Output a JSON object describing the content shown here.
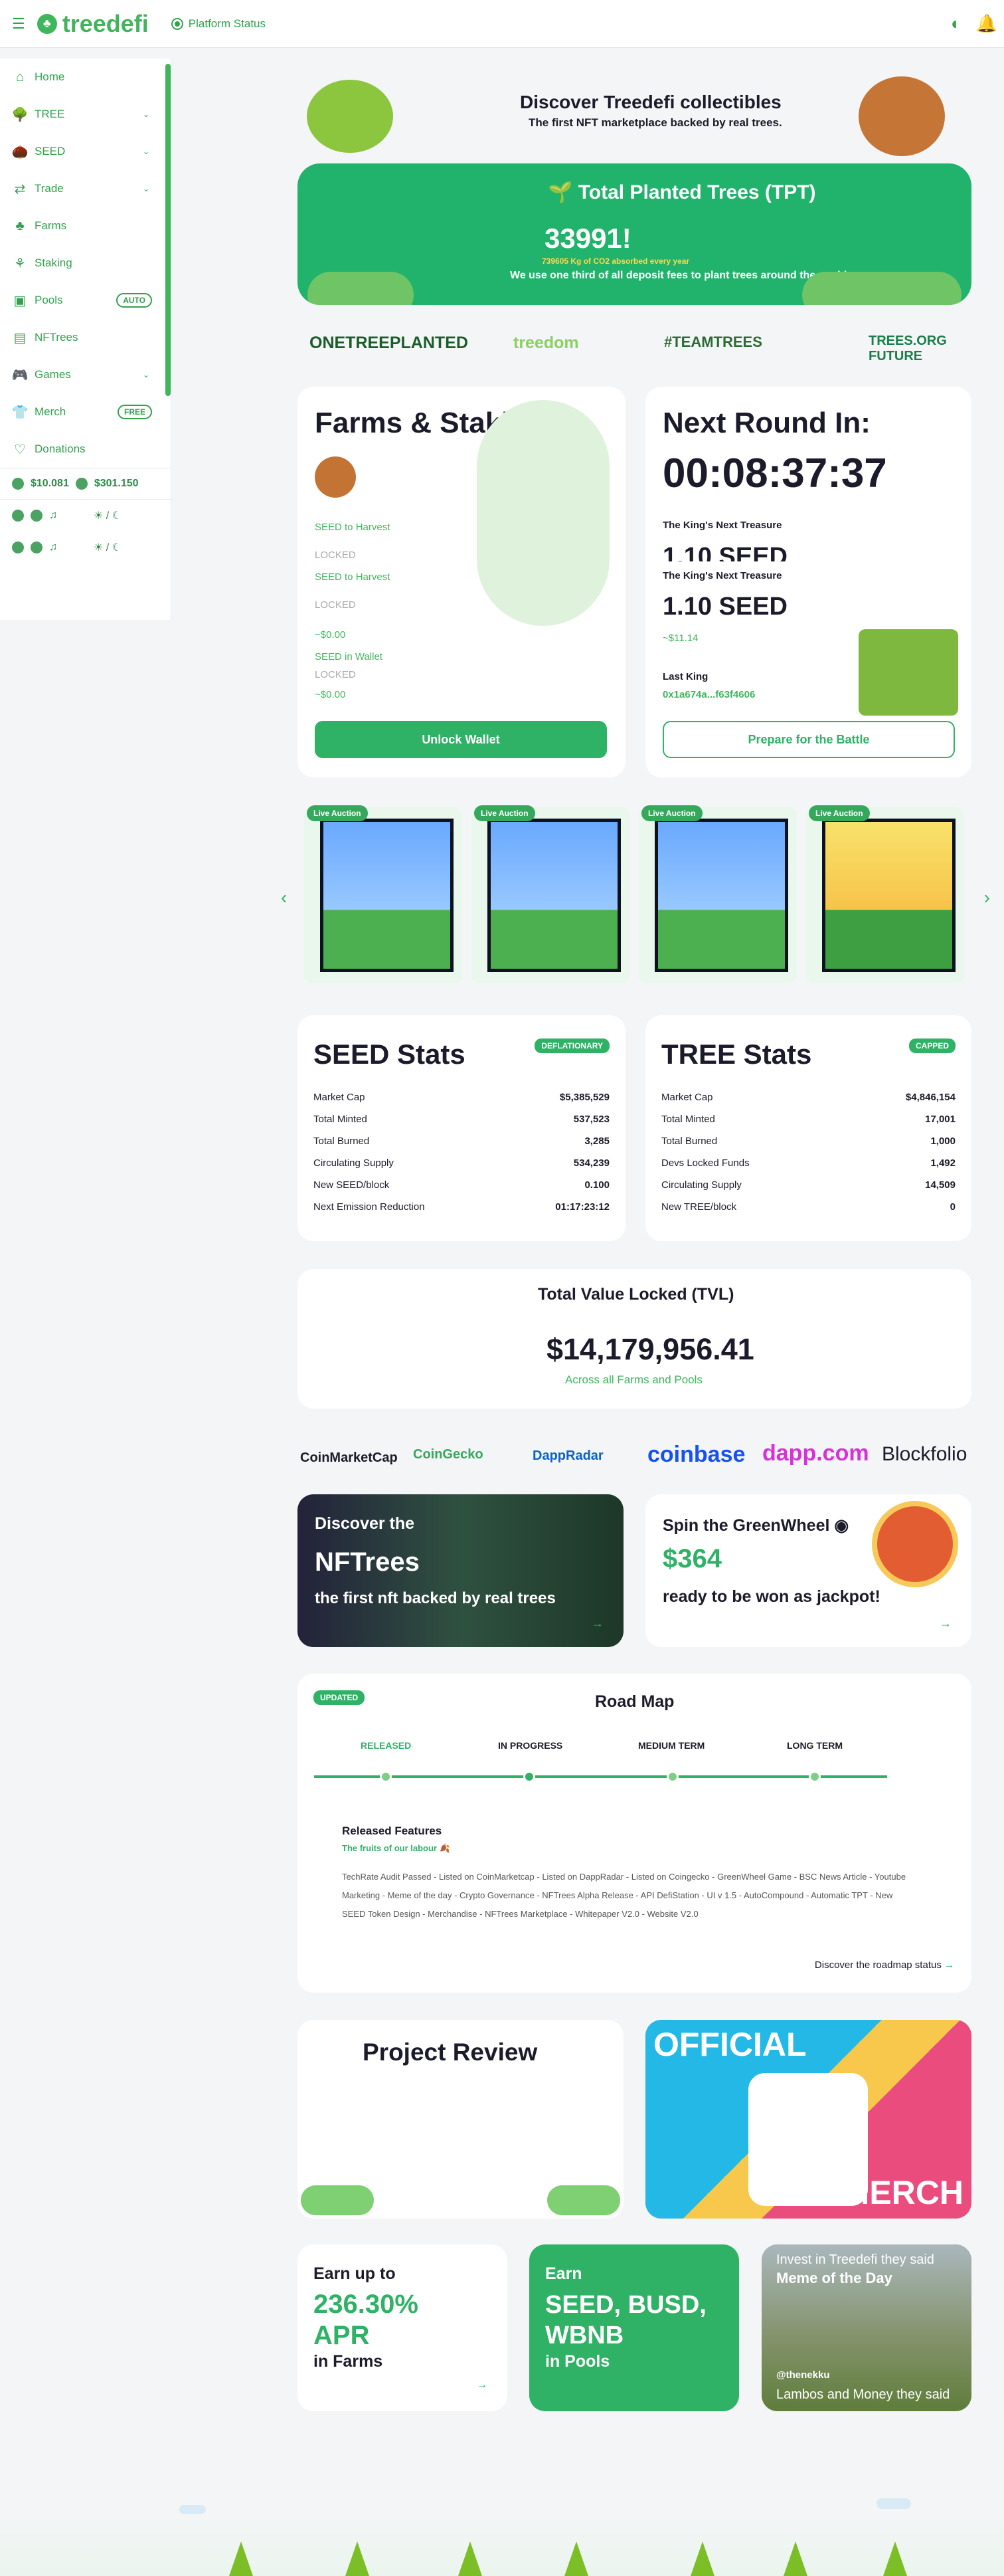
{
  "top": {
    "title": "treedefi",
    "status": "Platform Status"
  },
  "sidebar": {
    "items": [
      {
        "label": "Home"
      },
      {
        "label": "TREE"
      },
      {
        "label": "SEED"
      },
      {
        "label": "Trade"
      },
      {
        "label": "Farms"
      },
      {
        "label": "Staking"
      },
      {
        "label": "Pools",
        "badge": "AUTO"
      },
      {
        "label": "NFTrees"
      },
      {
        "label": "Games"
      },
      {
        "label": "Merch",
        "badge": "FREE"
      },
      {
        "label": "Donations"
      }
    ],
    "tree_price": "$10.081",
    "seed_price": "$301.150"
  },
  "hero": {
    "title": "Discover Treedefi collectibles",
    "subtitle": "The first NFT marketplace backed by real trees."
  },
  "tpt": {
    "title": "Total Planted Trees (TPT)",
    "count": "33991!",
    "co2": "739605 Kg of CO2 absorbed every year",
    "desc": "We use one third of all deposit fees to plant trees around the world"
  },
  "partners": [
    "ONETREEPLANTED",
    "treedom",
    "#TEAMTREES",
    "TREES.ORG FUTURE"
  ],
  "farms": {
    "title": "Farms & Staking",
    "seed_harvest": "SEED to Harvest",
    "locked": "LOCKED",
    "seed_wallet": "SEED in Wallet",
    "value": "~$0.00",
    "button": "Unlock Wallet"
  },
  "round": {
    "title": "Next Round In:",
    "timer": "00:08:37:37",
    "treasure_label": "The King's Next Treasure",
    "treasure_value": "1.10 SEED",
    "treasure_usd": "~$11.14",
    "last_king": "Last King",
    "last_king_addr": "0x1a674a...f63f4606",
    "button": "Prepare for the Battle"
  },
  "auctions": [
    {
      "tag": "Live Auction"
    },
    {
      "tag": "Live Auction"
    },
    {
      "tag": "Live Auction"
    },
    {
      "tag": "Live Auction"
    }
  ],
  "seed_stats": {
    "title": "SEED Stats",
    "badge": "DEFLATIONARY",
    "rows": [
      [
        "Market Cap",
        "$5,385,529"
      ],
      [
        "Total Minted",
        "537,523"
      ],
      [
        "Total Burned",
        "3,285"
      ],
      [
        "Circulating Supply",
        "534,239"
      ],
      [
        "New SEED/block",
        "0.100"
      ],
      [
        "Next Emission Reduction",
        "01:17:23:12"
      ]
    ]
  },
  "tree_stats": {
    "title": "TREE Stats",
    "badge": "CAPPED",
    "rows": [
      [
        "Market Cap",
        "$4,846,154"
      ],
      [
        "Total Minted",
        "17,001"
      ],
      [
        "Total Burned",
        "1,000"
      ],
      [
        "Devs Locked Funds",
        "1,492"
      ],
      [
        "Circulating Supply",
        "14,509"
      ],
      [
        "New TREE/block",
        "0"
      ]
    ]
  },
  "tvl": {
    "title": "Total Value Locked (TVL)",
    "value": "$14,179,956.41",
    "sub": "Across all Farms and Pools"
  },
  "exchanges": [
    "CoinMarketCap",
    "CoinGecko",
    "DappRadar",
    "coinbase",
    "dapp.com",
    "Blockfolio"
  ],
  "nftrees": {
    "line1": "Discover the",
    "line2": "NFTrees",
    "line3": "the first nft backed by real trees"
  },
  "greenwheel": {
    "title": "Spin the GreenWheel",
    "amount": "$364",
    "sub": "ready to be won as jackpot!"
  },
  "roadmap": {
    "badge": "UPDATED",
    "title": "Road Map",
    "phases": [
      "RELEASED",
      "IN PROGRESS",
      "MEDIUM TERM",
      "LONG TERM"
    ],
    "features_title": "Released Features",
    "features_sub": "The fruits of our labour",
    "features": "TechRate Audit Passed - Listed on CoinMarketcap - Listed on DappRadar - Listed on Coingecko - GreenWheel Game - BSC News Article - Youtube Marketing - Meme of the day - Crypto Governance - NFTrees Alpha Release - API DefiStation - UI v 1.5 - AutoCompound - Automatic TPT - New SEED Token Design - Merchandise - NFTrees Marketplace - Whitepaper V2.0 - Website V2.0",
    "link": "Discover the roadmap status"
  },
  "review": {
    "title": "Project Review"
  },
  "merch": {
    "line1": "OFFICIAL",
    "line2": "MERCH"
  },
  "apr": {
    "line1": "Earn up to",
    "value": "236.30%",
    "unit": "APR",
    "line2": "in Farms"
  },
  "pools": {
    "line1": "Earn",
    "line2": "SEED, BUSD, WBNB",
    "line3": "in Pools"
  },
  "meme": {
    "title": "Meme of the Day",
    "top": "Invest in Treedefi they said",
    "user": "@thenekku",
    "bottom": "Lambos and Money they said"
  }
}
